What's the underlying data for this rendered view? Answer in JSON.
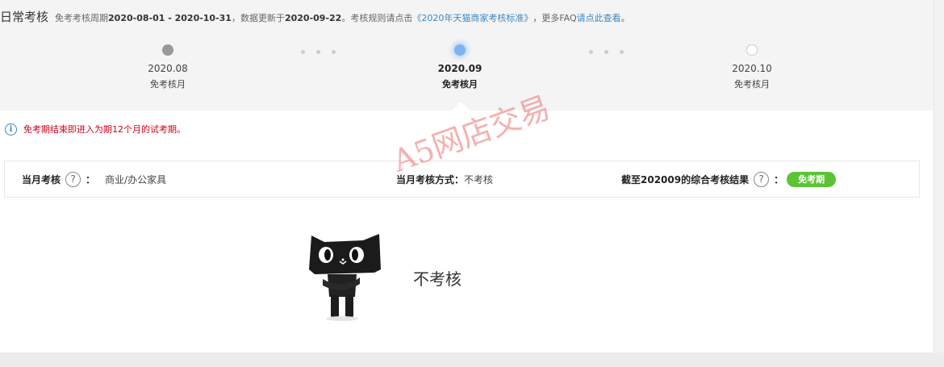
{
  "header": {
    "title": "日常考核",
    "desc_prefix": "免考考核周期",
    "period": "2020-08-01 - 2020-10-31",
    "desc_mid": "，数据更新于",
    "update_date": "2020-09-22",
    "desc_rule": "。考核规则请点击",
    "rule_link": "《2020年天猫商家考核标准》",
    "desc_faq": "，更多FAQ",
    "faq_link": "请点此查看",
    "desc_end": "。"
  },
  "timeline": {
    "steps": [
      {
        "month": "2020.08",
        "status": "免考核月",
        "dot": "past"
      },
      {
        "month": "2020.09",
        "status": "免考核月",
        "dot": "current"
      },
      {
        "month": "2020.10",
        "status": "免考核月",
        "dot": "future"
      }
    ]
  },
  "notice": {
    "icon": "info-icon",
    "text": "免考期结束即进入为期12个月的试考期。"
  },
  "summary": {
    "month_label": "当月考核",
    "help_glyph": "?",
    "colon": "：",
    "category": "商业/办公家具",
    "method_label": "当月考核方式：",
    "method_value": "不考核",
    "result_label": "截至202009的综合考核结果",
    "result_badge": "免考期"
  },
  "watermark": "A5网店交易",
  "empty_state": {
    "icon": "tmall-cat-mascot",
    "text": "不考核"
  },
  "colors": {
    "accent_link": "#3d88c7",
    "notice_red": "#d0021b",
    "badge_green": "#5cc335",
    "active_dot": "#7db4f0"
  }
}
